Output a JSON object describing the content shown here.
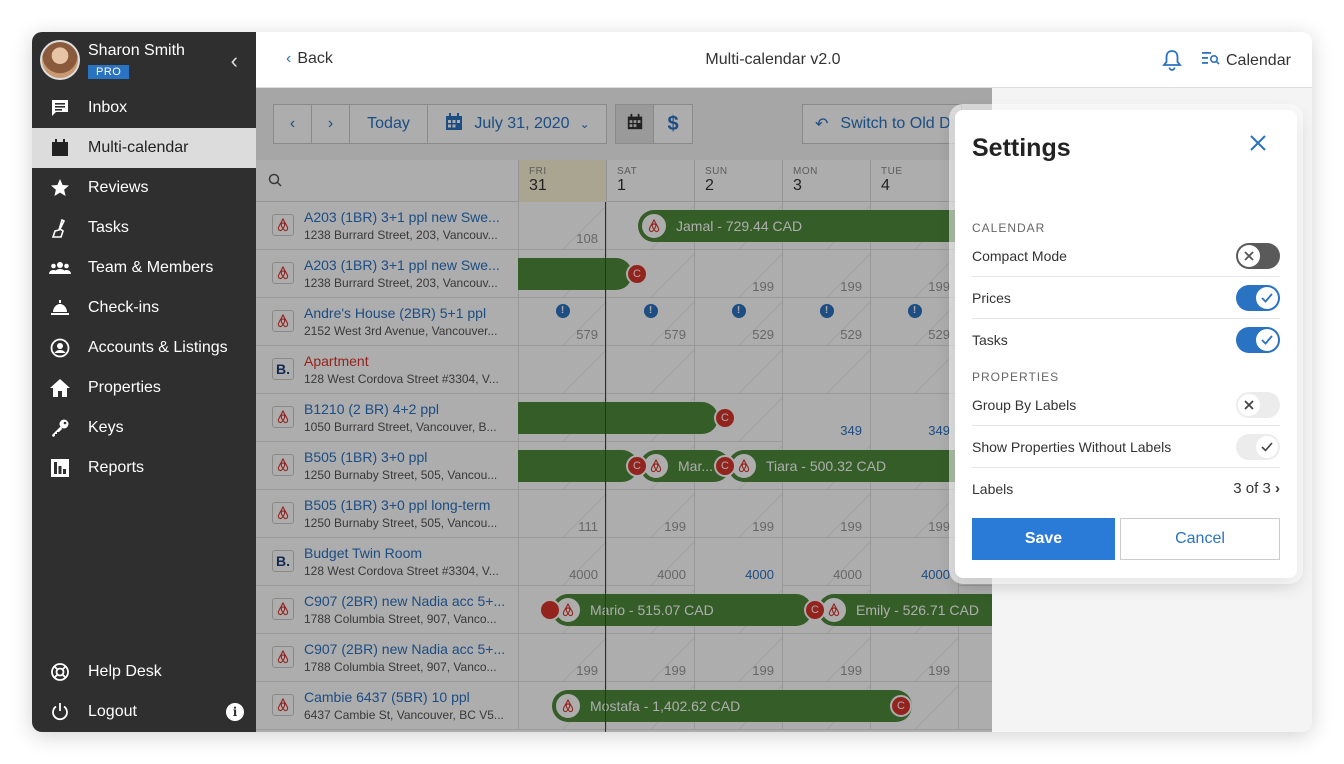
{
  "user": {
    "name": "Sharon Smith",
    "badge": "PRO"
  },
  "nav": [
    {
      "label": "Inbox",
      "icon": "inbox-icon"
    },
    {
      "label": "Multi-calendar",
      "icon": "calendar-icon",
      "active": true
    },
    {
      "label": "Reviews",
      "icon": "star-icon"
    },
    {
      "label": "Tasks",
      "icon": "broom-icon"
    },
    {
      "label": "Team & Members",
      "icon": "team-icon"
    },
    {
      "label": "Check-ins",
      "icon": "bell-desk-icon"
    },
    {
      "label": "Accounts & Listings",
      "icon": "account-icon"
    },
    {
      "label": "Properties",
      "icon": "home-icon"
    },
    {
      "label": "Keys",
      "icon": "key-icon"
    },
    {
      "label": "Reports",
      "icon": "reports-icon"
    }
  ],
  "bottom_nav": {
    "help": "Help Desk",
    "logout": "Logout",
    "info": "i"
  },
  "header": {
    "back": "Back",
    "title": "Multi-calendar v2.0",
    "calendar": "Calendar"
  },
  "toolbar": {
    "today": "Today",
    "date": "July 31, 2020",
    "switch": "Switch to Old D"
  },
  "days": [
    {
      "dow": "FRI",
      "num": "31"
    },
    {
      "dow": "SAT",
      "num": "1"
    },
    {
      "dow": "SUN",
      "num": "2"
    },
    {
      "dow": "MON",
      "num": "3"
    },
    {
      "dow": "TUE",
      "num": "4"
    }
  ],
  "properties": [
    {
      "name": "A203 (1BR) 3+1 ppl new Swe...",
      "addr": "1238 Burrard Street, 203, Vancouv...",
      "logo": "airbnb",
      "prices": [
        "108",
        "",
        "",
        "",
        ""
      ]
    },
    {
      "name": "A203 (1BR) 3+1 ppl new Swe...",
      "addr": "1238 Burrard Street, 203, Vancouv...",
      "logo": "airbnb",
      "prices": [
        "",
        "",
        "199",
        "199",
        "199"
      ]
    },
    {
      "name": "Andre's House (2BR) 5+1 ppl",
      "addr": "2152 West 3rd Avenue, Vancouver...",
      "logo": "airbnb",
      "prices": [
        "579",
        "579",
        "529",
        "529",
        "529"
      ]
    },
    {
      "name": "Apartment",
      "addr": "128 West Cordova Street #3304, V...",
      "logo": "booking",
      "red": true,
      "prices": [
        "",
        "",
        "",
        "",
        ""
      ]
    },
    {
      "name": "B1210 (2 BR) 4+2 ppl",
      "addr": "1050 Burrard Street, Vancouver, B...",
      "logo": "airbnb",
      "prices": [
        "",
        "",
        "",
        "349",
        "349"
      ]
    },
    {
      "name": "B505 (1BR) 3+0 ppl",
      "addr": "1250 Burnaby Street, 505, Vancou...",
      "logo": "airbnb",
      "prices": [
        "",
        "",
        "",
        "",
        ""
      ]
    },
    {
      "name": "B505 (1BR) 3+0 ppl long-term",
      "addr": "1250 Burnaby Street, 505, Vancou...",
      "logo": "airbnb",
      "prices": [
        "111",
        "199",
        "199",
        "199",
        "199"
      ]
    },
    {
      "name": "Budget Twin Room",
      "addr": "128 West Cordova Street #3304, V...",
      "logo": "booking",
      "prices": [
        "4000",
        "4000",
        "4000",
        "4000",
        "4000"
      ]
    },
    {
      "name": "C907 (2BR) new Nadia acc 5+...",
      "addr": "1788 Columbia Street, 907, Vanco...",
      "logo": "airbnb",
      "prices": [
        "",
        "",
        "",
        "",
        ""
      ]
    },
    {
      "name": "C907 (2BR) new Nadia acc 5+...",
      "addr": "1788 Columbia Street, 907, Vanco...",
      "logo": "airbnb",
      "prices": [
        "199",
        "199",
        "199",
        "199",
        "199"
      ]
    },
    {
      "name": "Cambie 6437 (5BR) 10 ppl",
      "addr": "6437 Cambie St, Vancouver, BC V5...",
      "logo": "airbnb",
      "prices": [
        "",
        "",
        "",
        "",
        ""
      ]
    }
  ],
  "bookings": {
    "jamal": "Jamal - 729.44 CAD",
    "mar": "Mar...",
    "tiara": "Tiara - 500.32 CAD",
    "mario": "Mario - 515.07 CAD",
    "emily": "Emily - 526.71 CAD",
    "mostafa": "Mostafa - 1,402.62 CAD",
    "c": "C"
  },
  "settings": {
    "title": "Settings",
    "section_calendar": "CALENDAR",
    "compact_mode": "Compact Mode",
    "prices": "Prices",
    "tasks": "Tasks",
    "section_properties": "PROPERTIES",
    "group_by_labels": "Group By Labels",
    "show_without_labels": "Show Properties Without Labels",
    "labels": "Labels",
    "labels_value": "3 of 3",
    "save": "Save",
    "cancel": "Cancel",
    "toggles": {
      "compact_mode": false,
      "prices": true,
      "tasks": true,
      "group_by_labels": false,
      "show_without_labels": true
    }
  },
  "colors": {
    "accent": "#2a72c2",
    "booking_bar": "#4f8a3c",
    "sidebar": "#2f2f2f",
    "alert": "#d9342b"
  }
}
